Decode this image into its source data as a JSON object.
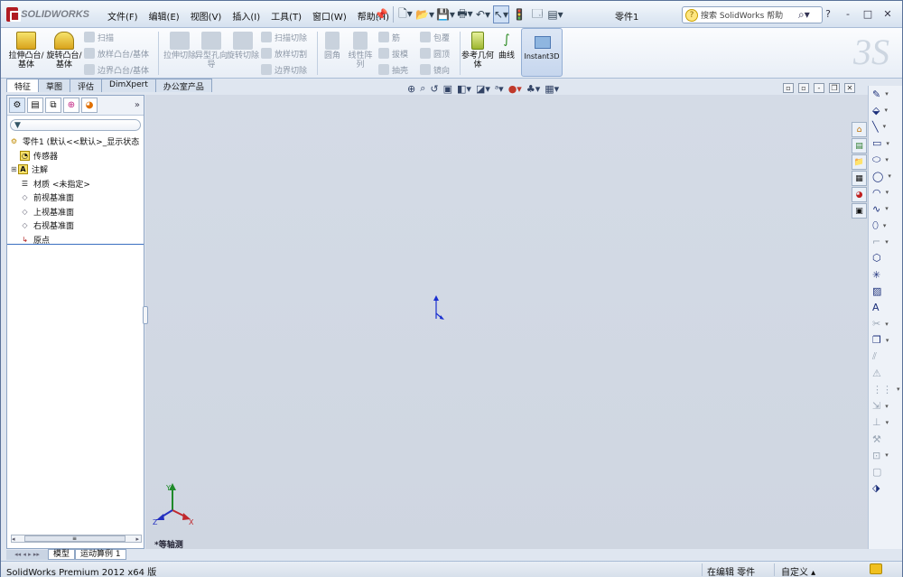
{
  "app": {
    "logo_text": "SOLIDWORKS",
    "doc_title": "零件1"
  },
  "menu": [
    "文件(F)",
    "编辑(E)",
    "视图(V)",
    "插入(I)",
    "工具(T)",
    "窗口(W)",
    "帮助(H)"
  ],
  "search": {
    "value": "搜索 SolidWorks 帮助",
    "help_icon": "?"
  },
  "window_controls": [
    "?",
    "-",
    "□",
    "✕"
  ],
  "ribbon": {
    "extrude_boss": "拉伸凸台/基体",
    "revolve_boss": "旋转凸台/基体",
    "sweep": "扫描",
    "loft": "放样凸台/基体",
    "boundary": "边界凸台/基体",
    "extrude_cut": "拉伸切除",
    "hole_wizard": "异型孔向导",
    "revolve_cut": "旋转切除",
    "swept_cut": "扫描切除",
    "lofted_cut": "放样切割",
    "boundary_cut": "边界切除",
    "fillet": "圆角",
    "linear_pattern": "线性阵列",
    "rib": "筋",
    "draft": "拔模",
    "shell": "抽壳",
    "wrap": "包覆",
    "dome": "圆顶",
    "mirror": "镜向",
    "ref_geometry": "参考几何体",
    "curves": "曲线",
    "instant3d": "Instant3D"
  },
  "cm_tabs": [
    "特征",
    "草图",
    "评估",
    "DimXpert",
    "办公室产品"
  ],
  "tree": {
    "root": "零件1 (默认<<默认>_显示状态",
    "items": [
      "传感器",
      "注解",
      "材质 <未指定>",
      "前视基准面",
      "上视基准面",
      "右视基准面",
      "原点"
    ]
  },
  "bottom_tabs": [
    "模型",
    "运动算例 1"
  ],
  "view_name": "*等轴测",
  "triad": {
    "x": "X",
    "y": "Y",
    "z": "Z"
  },
  "status": {
    "product": "SolidWorks Premium 2012 x64 版",
    "editing": "在编辑 零件",
    "custom": "自定义"
  }
}
